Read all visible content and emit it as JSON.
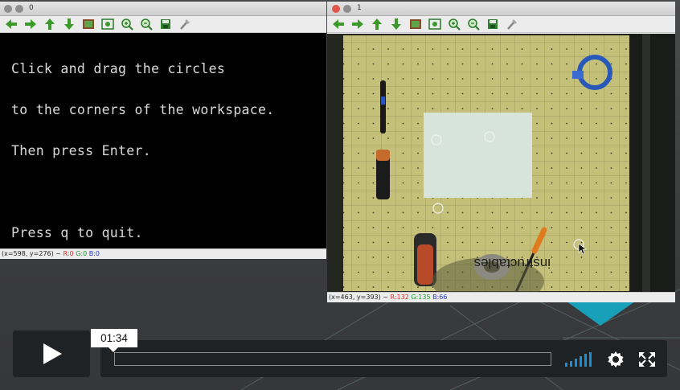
{
  "window0": {
    "title": "0",
    "console_lines": [
      "Click and drag the circles",
      "to the corners of the workspace.",
      "Then press Enter.",
      "",
      "Press q to quit."
    ],
    "status_coords": "(x=598, y=276) ~",
    "status_r": "R:0",
    "status_g": "G:0",
    "status_b": "B:0"
  },
  "window1": {
    "title": "1",
    "status_coords": "(x=463, y=393) ~",
    "status_r": "R:132",
    "status_g": "G:135",
    "status_b": "B:66",
    "camera_brand_text": "instructables"
  },
  "toolbar_icons": [
    "arrow-left-icon",
    "arrow-right-icon",
    "arrow-up-icon",
    "arrow-down-icon",
    "image-save-icon",
    "zoom-fit-icon",
    "zoom-in-icon",
    "zoom-out-icon",
    "save-icon",
    "settings-icon"
  ],
  "player": {
    "time_tooltip": "01:34",
    "progress_fraction": 0.0
  },
  "colors": {
    "toolbar_arrow": "#3c9a2a",
    "player_accent": "#1a8fd6",
    "camera_board": "#c4c07a"
  }
}
